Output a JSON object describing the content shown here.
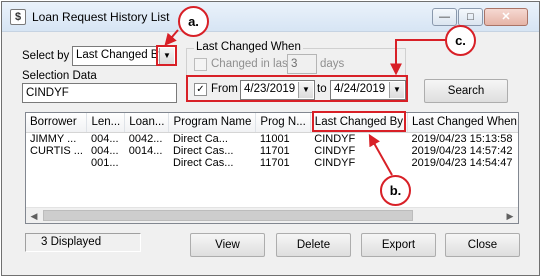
{
  "window": {
    "title": "Loan Request History List",
    "app_icon": "dollar-sign-icon",
    "controls": {
      "minimize": "—",
      "maximize": "□",
      "close": "✕"
    }
  },
  "select_by": {
    "label": "Select by",
    "value": "Last Changed By"
  },
  "selection_data": {
    "label": "Selection Data",
    "value": "CINDYF"
  },
  "last_changed_when": {
    "group_label": "Last Changed When",
    "changed_in_last_label": "Changed in last",
    "changed_in_last_checked": false,
    "days_value": "3",
    "days_label": "days",
    "from_checked": true,
    "from_label": "From",
    "from_date": "4/23/2019",
    "to_label": "to",
    "to_date": "4/24/2019"
  },
  "search_button": "Search",
  "table": {
    "columns": [
      "Borrower",
      "Len...",
      "Loan...",
      "Program Name",
      "Prog N...",
      "Last Changed By",
      "Last Changed When"
    ],
    "rows": [
      [
        "JIMMY ...",
        "004...",
        "0042...",
        "Direct Ca...",
        "11001",
        "CINDYF",
        "2019/04/23 15:13:58"
      ],
      [
        "CURTIS ...",
        "004...",
        "0014...",
        "Direct Cas...",
        "11701",
        "CINDYF",
        "2019/04/23 14:57:42"
      ],
      [
        "",
        "001...",
        "",
        "Direct Cas...",
        "11701",
        "CINDYF",
        "2019/04/23 14:54:47"
      ]
    ]
  },
  "status": "3 Displayed",
  "buttons": {
    "view": "View",
    "delete": "Delete",
    "export": "Export",
    "close": "Close"
  },
  "callouts": {
    "a": "a.",
    "b": "b.",
    "c": "c."
  },
  "annotation_color": "#d82027"
}
